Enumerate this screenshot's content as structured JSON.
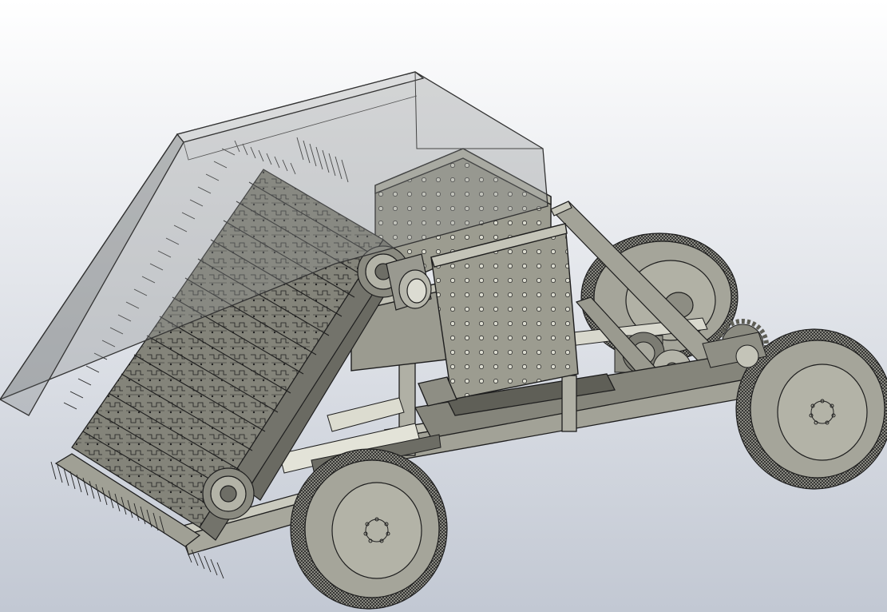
{
  "scene": {
    "background_top": "#ffffff",
    "background_bottom": "#c2c8d3",
    "part_color": "#9c9c90",
    "part_dark": "#6f6f66",
    "part_light": "#c9c9bd",
    "edge_color": "#1e1e1e",
    "glass_color": "#8e9393",
    "tire_color": "#9e9e94",
    "icons": {
      "frame": "chassis-frame",
      "conveyor": "conveyor-belt-with-tines",
      "hopper": "perforated-hopper",
      "cover": "transparent-cover",
      "wheels": "wheel-icon",
      "drive": "gear-icon"
    }
  }
}
